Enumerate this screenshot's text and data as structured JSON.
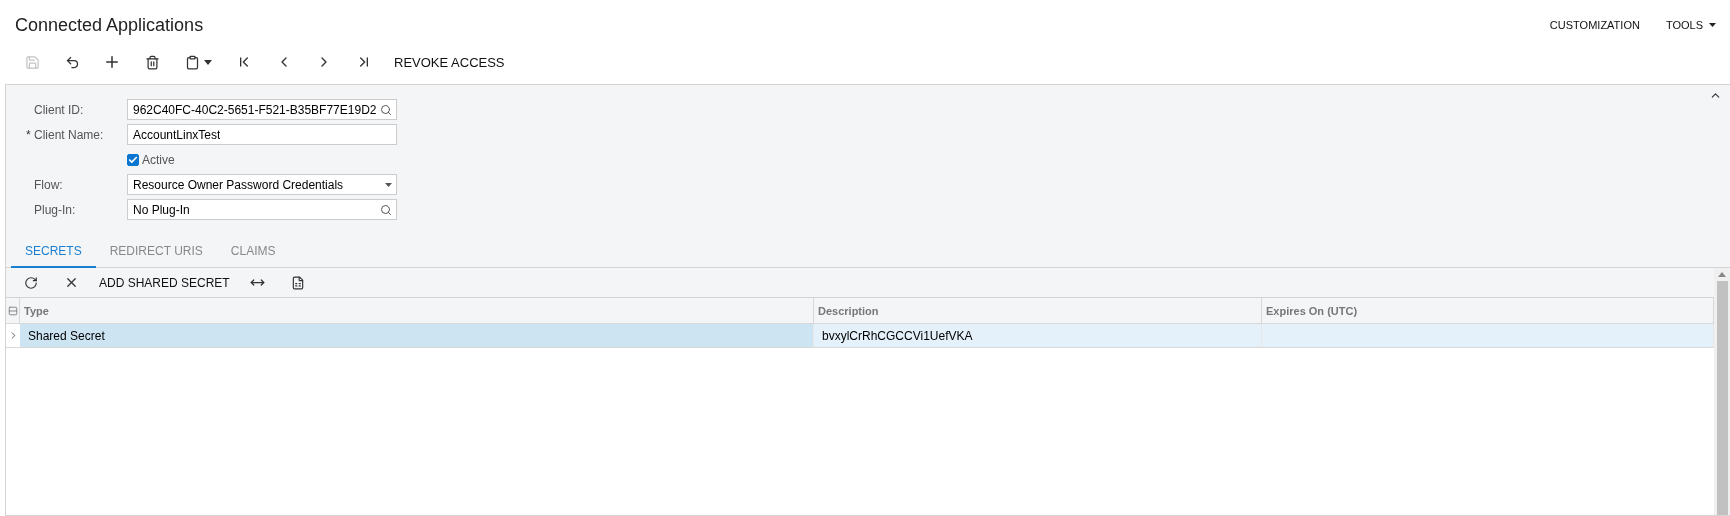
{
  "title": "Connected Applications",
  "top_menu": [
    {
      "label": "CUSTOMIZATION",
      "kind": "link"
    },
    {
      "label": "TOOLS",
      "kind": "dropdown"
    }
  ],
  "toolbar": {
    "actions": [
      {
        "kind": "save",
        "disabled": true
      },
      {
        "kind": "undo",
        "disabled": false
      },
      {
        "kind": "add",
        "disabled": false
      },
      {
        "kind": "delete",
        "disabled": false
      },
      {
        "kind": "paste",
        "disabled": false
      },
      {
        "kind": "first",
        "disabled": false
      },
      {
        "kind": "prev",
        "disabled": false
      },
      {
        "kind": "next",
        "disabled": false
      },
      {
        "kind": "last",
        "disabled": false
      }
    ],
    "text_button": "REVOKE ACCESS"
  },
  "form": {
    "fields": [
      {
        "kind": "lookup",
        "label": "Client ID:",
        "value": "962C40FC-40C2-5651-F521-B35BF77E19D2"
      },
      {
        "kind": "text",
        "label": "Client Name:",
        "required_mark": "*",
        "value": "AccountLinxTest"
      },
      {
        "kind": "checkbox",
        "label": "Active",
        "checked": true
      },
      {
        "kind": "select",
        "label": "Flow:",
        "value": "Resource Owner Password Credentials"
      },
      {
        "kind": "lookup",
        "label": "Plug-In:",
        "value": "No Plug-In"
      }
    ]
  },
  "tabs": [
    {
      "label": "SECRETS",
      "selected": true
    },
    {
      "label": "REDIRECT URIS",
      "selected": false
    },
    {
      "label": "CLAIMS",
      "selected": false
    }
  ],
  "grid_toolbar": [
    {
      "kind": "refresh"
    },
    {
      "kind": "remove"
    },
    {
      "kind": "text",
      "label": "ADD SHARED SECRET"
    },
    {
      "kind": "fit"
    },
    {
      "kind": "excel"
    }
  ],
  "table": {
    "columns": [
      "Type",
      "Description",
      "Expires On (UTC)"
    ],
    "rows": [
      {
        "selected": true,
        "cells": [
          "Shared Secret",
          "bvxylCrRhCGCCVi1UefVKA",
          ""
        ]
      }
    ]
  }
}
